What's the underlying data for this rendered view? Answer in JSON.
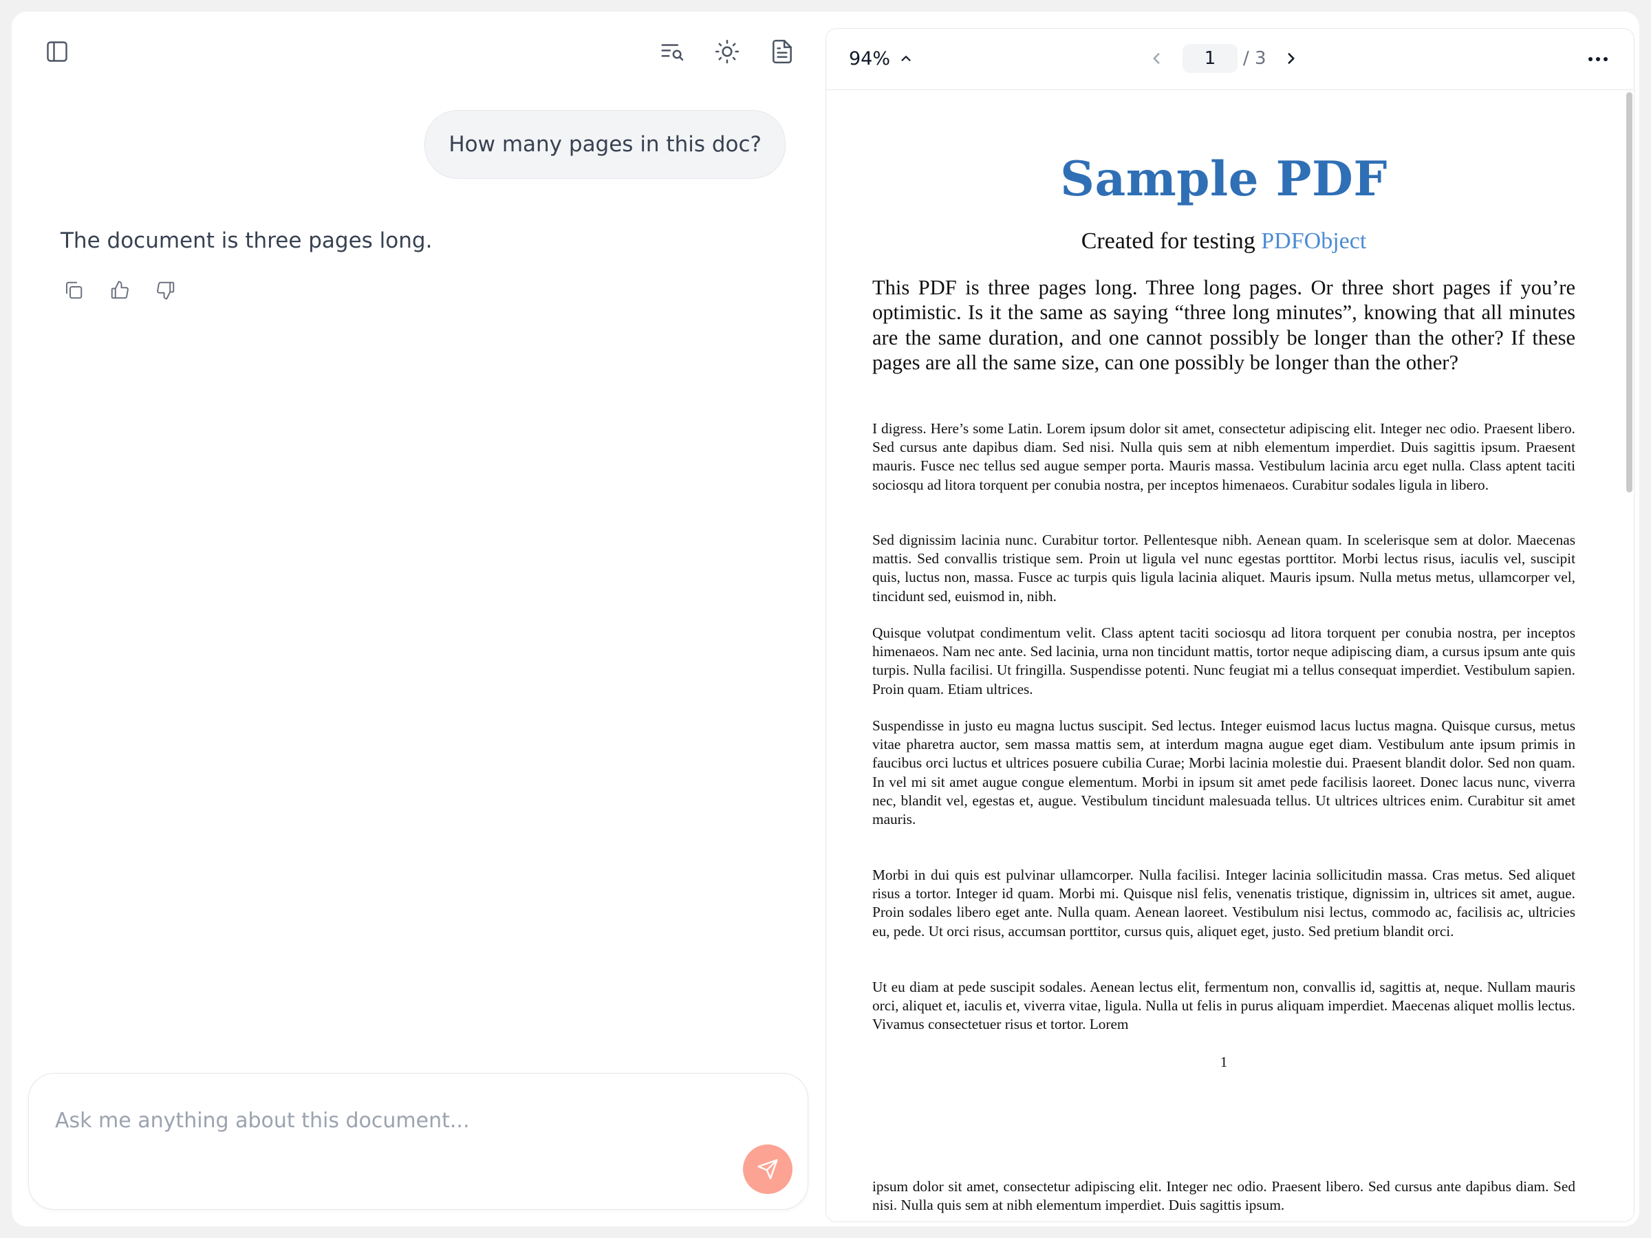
{
  "chat": {
    "user_message": "How many pages in this doc?",
    "assistant_message": "The document is three pages long.",
    "composer_placeholder": "Ask me anything about this document..."
  },
  "toolbar_icons": {
    "sidebar": "sidebar-toggle-icon",
    "search": "search-list-icon",
    "theme": "sun-icon",
    "document": "document-icon"
  },
  "colors": {
    "accent_send": "#fca394",
    "pdf_title": "#2f6fb5",
    "pdf_link": "#4d8cd3"
  },
  "viewer": {
    "zoom": "94%",
    "current_page": "1",
    "total_pages": "/ 3"
  },
  "pdf": {
    "title": "Sample PDF",
    "subtitle_prefix": "Created for testing",
    "subtitle_link": "PDFObject",
    "lead": "This PDF is three pages long. Three long pages. Or three short pages if you’re optimistic. Is it the same as saying “three long minutes”, knowing that all minutes are the same duration, and one cannot possibly be longer than the other? If these pages are all the same size, can one possibly be longer than the other?",
    "paragraphs": [
      "I digress. Here’s some Latin. Lorem ipsum dolor sit amet, consectetur adipiscing elit. Integer nec odio. Praesent libero. Sed cursus ante dapibus diam. Sed nisi. Nulla quis sem at nibh elementum imperdiet. Duis sagittis ipsum. Praesent mauris. Fusce nec tellus sed augue semper porta. Mauris massa. Vestibulum lacinia arcu eget nulla. Class aptent taciti sociosqu ad litora torquent per conubia nostra, per inceptos himenaeos. Curabitur sodales ligula in libero.",
      "Sed dignissim lacinia nunc. Curabitur tortor. Pellentesque nibh. Aenean quam. In scelerisque sem at dolor. Maecenas mattis. Sed convallis tristique sem. Proin ut ligula vel nunc egestas porttitor. Morbi lectus risus, iaculis vel, suscipit quis, luctus non, massa. Fusce ac turpis quis ligula lacinia aliquet. Mauris ipsum. Nulla metus metus, ullamcorper vel, tincidunt sed, euismod in, nibh.",
      "Quisque volutpat condimentum velit. Class aptent taciti sociosqu ad litora torquent per conubia nostra, per inceptos himenaeos. Nam nec ante. Sed lacinia, urna non tincidunt mattis, tortor neque adipiscing diam, a cursus ipsum ante quis turpis. Nulla facilisi. Ut fringilla. Suspendisse potenti. Nunc feugiat mi a tellus consequat imperdiet. Vestibulum sapien. Proin quam. Etiam ultrices.",
      "Suspendisse in justo eu magna luctus suscipit. Sed lectus. Integer euismod lacus luctus magna. Quisque cursus, metus vitae pharetra auctor, sem massa mattis sem, at interdum magna augue eget diam. Vestibulum ante ipsum primis in faucibus orci luctus et ultrices posuere cubilia Curae; Morbi lacinia molestie dui. Praesent blandit dolor. Sed non quam. In vel mi sit amet augue congue elementum. Morbi in ipsum sit amet pede facilisis laoreet. Donec lacus nunc, viverra nec, blandit vel, egestas et, augue. Vestibulum tincidunt malesuada tellus. Ut ultrices ultrices enim. Curabitur sit amet mauris.",
      "Morbi in dui quis est pulvinar ullamcorper. Nulla facilisi. Integer lacinia sollicitudin massa. Cras metus. Sed aliquet risus a tortor. Integer id quam. Morbi mi. Quisque nisl felis, venenatis tristique, dignissim in, ultrices sit amet, augue. Proin sodales libero eget ante. Nulla quam. Aenean laoreet. Vestibulum nisi lectus, commodo ac, facilisis ac, ultricies eu, pede. Ut orci risus, accumsan porttitor, cursus quis, aliquet eget, justo. Sed pretium blandit orci.",
      "Ut eu diam at pede suscipit sodales. Aenean lectus elit, fermentum non, convallis id, sagittis at, neque. Nullam mauris orci, aliquet et, iaculis et, viverra vitae, ligula. Nulla ut felis in purus aliquam imperdiet. Maecenas aliquet mollis lectus. Vivamus consectetuer risus et tortor. Lorem"
    ],
    "page_number": "1",
    "next_page_text": "ipsum dolor sit amet, consectetur adipiscing elit. Integer nec odio. Praesent libero. Sed cursus ante dapibus diam. Sed nisi. Nulla quis sem at nibh elementum imperdiet. Duis sagittis ipsum."
  }
}
